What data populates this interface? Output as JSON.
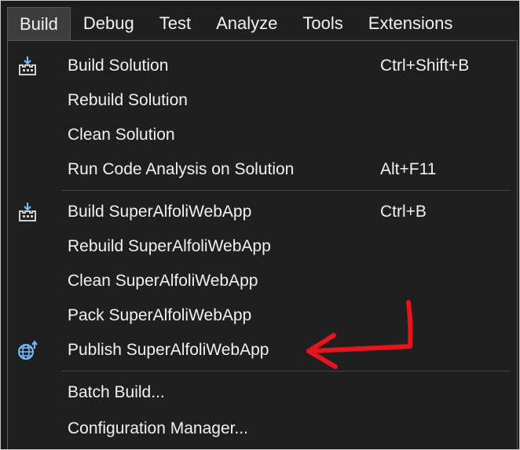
{
  "menubar": {
    "items": [
      "Build",
      "Debug",
      "Test",
      "Analyze",
      "Tools",
      "Extensions"
    ],
    "active_index": 0
  },
  "dropdown": {
    "items": [
      {
        "label": "Build Solution",
        "shortcut": "Ctrl+Shift+B",
        "icon": "build-icon"
      },
      {
        "label": "Rebuild Solution",
        "shortcut": "",
        "icon": ""
      },
      {
        "label": "Clean Solution",
        "shortcut": "",
        "icon": ""
      },
      {
        "label": "Run Code Analysis on Solution",
        "shortcut": "Alt+F11",
        "icon": ""
      },
      {
        "label": "Build SuperAlfoliWebApp",
        "shortcut": "Ctrl+B",
        "icon": "build-icon"
      },
      {
        "label": "Rebuild SuperAlfoliWebApp",
        "shortcut": "",
        "icon": ""
      },
      {
        "label": "Clean SuperAlfoliWebApp",
        "shortcut": "",
        "icon": ""
      },
      {
        "label": "Pack SuperAlfoliWebApp",
        "shortcut": "",
        "icon": ""
      },
      {
        "label": "Publish SuperAlfoliWebApp",
        "shortcut": "",
        "icon": "publish-globe-icon"
      },
      {
        "label": "Batch Build...",
        "shortcut": "",
        "icon": ""
      },
      {
        "label": "Configuration Manager...",
        "shortcut": "",
        "icon": ""
      }
    ]
  },
  "colors": {
    "menu_background": "#1f1f1f",
    "text": "#f1f1f1",
    "icon_blue": "#75beff",
    "annotation_arrow": "#e8141c"
  },
  "annotation": {
    "type": "arrow",
    "target": "Publish SuperAlfoliWebApp"
  }
}
